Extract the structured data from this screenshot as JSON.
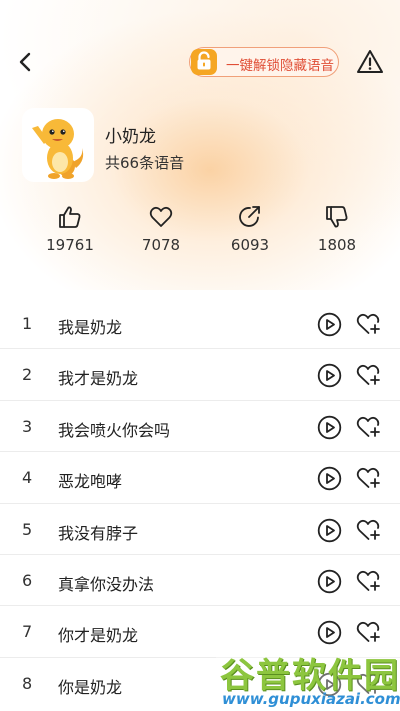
{
  "header": {
    "unlock_label": "一键解锁隐藏语音"
  },
  "profile": {
    "name": "小奶龙",
    "count": "共66条语音"
  },
  "stats": [
    {
      "icon": "thumbs-up-icon",
      "value": "19761"
    },
    {
      "icon": "heart-icon",
      "value": "7078"
    },
    {
      "icon": "share-icon",
      "value": "6093"
    },
    {
      "icon": "thumbs-down-icon",
      "value": "1808"
    }
  ],
  "voices": [
    {
      "index": "1",
      "title": "我是奶龙"
    },
    {
      "index": "2",
      "title": "我才是奶龙"
    },
    {
      "index": "3",
      "title": "我会喷火你会吗"
    },
    {
      "index": "4",
      "title": "恶龙咆哮"
    },
    {
      "index": "5",
      "title": "我没有脖子"
    },
    {
      "index": "6",
      "title": "真拿你没办法"
    },
    {
      "index": "7",
      "title": "你才是奶龙"
    },
    {
      "index": "8",
      "title": "你是奶龙"
    }
  ],
  "watermark": {
    "name": "谷普软件园",
    "url": "www.gupuxiazai.com"
  },
  "colors": {
    "accent": "#e04e36",
    "lock_badge": "#f5a623",
    "gradient": "#facb96"
  }
}
